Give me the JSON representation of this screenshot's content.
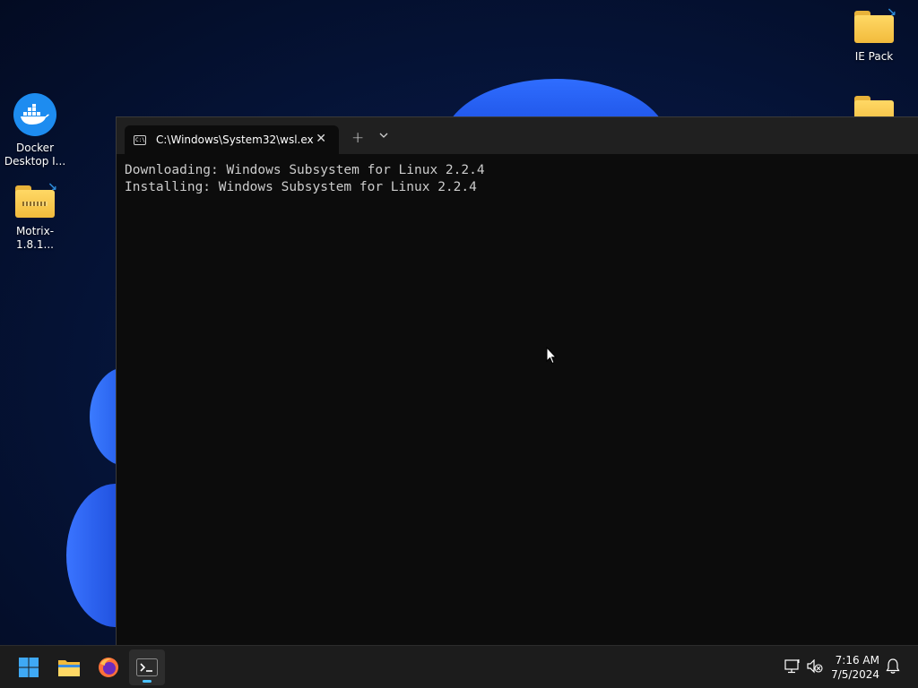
{
  "desktop": {
    "icons": [
      {
        "label_line1": "Docker",
        "label_line2": "Desktop I..."
      },
      {
        "label_line1": "Motrix-1.8.1..."
      },
      {
        "label_line1": "IE Pack"
      }
    ]
  },
  "terminal": {
    "tab_title": "C:\\Windows\\System32\\wsl.ex",
    "tab_icon_text": "C:\\",
    "new_tab_glyph": "+",
    "close_glyph": "✕",
    "lines": [
      "Downloading: Windows Subsystem for Linux 2.2.4",
      "Installing: Windows Subsystem for Linux 2.2.4"
    ]
  },
  "taskbar": {
    "time": "7:16 AM",
    "date": "7/5/2024"
  },
  "colors": {
    "accent": "#4cc2ff",
    "terminal_bg": "#0c0c0c",
    "tabbar_bg": "#202020",
    "taskbar_bg": "#1c1c1c"
  }
}
